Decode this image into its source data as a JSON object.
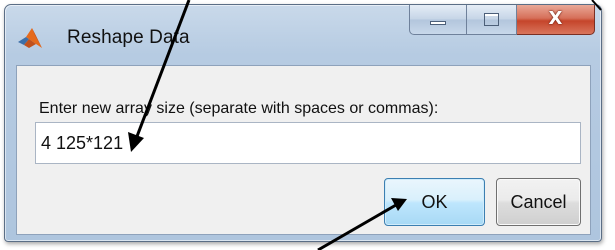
{
  "window": {
    "title": "Reshape Data",
    "caption_buttons": {
      "minimize_glyph": "minimize-icon",
      "maximize_glyph": "maximize-icon",
      "close_label": "X"
    }
  },
  "form": {
    "prompt": "Enter new array size (separate with spaces or commas):",
    "array_size_value": "4 125*121"
  },
  "buttons": {
    "ok": "OK",
    "cancel": "Cancel"
  },
  "icons": {
    "app": "matlab-logo-icon",
    "annotation": "arrow-annotation"
  },
  "colors": {
    "title_bar": "#b6cbe2",
    "close_button": "#c5452b",
    "ok_button_border": "#3c7fb1",
    "dialog_body": "#f0f0f0",
    "annotation_arrow": "#000000"
  }
}
